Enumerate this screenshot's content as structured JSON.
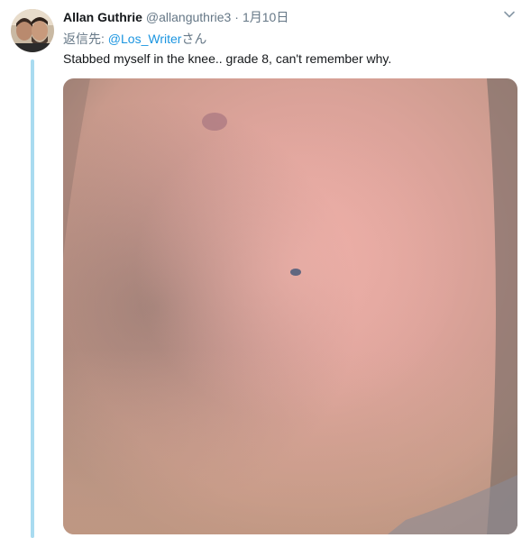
{
  "tweet": {
    "author_name": "Allan Guthrie",
    "author_handle": "@allanguthrie3",
    "separator": "·",
    "date": "1月10日",
    "reply_prefix": "返信先: ",
    "reply_mention": "@Los_Writer",
    "reply_suffix": "さん",
    "text": "Stabbed myself in the knee.. grade 8, can't remember why.",
    "avatar_icon": "user-avatar-photo",
    "menu_icon": "chevron-down-icon",
    "thread_line_color": "#a9dbf0",
    "mention_color": "#1b95e0"
  }
}
